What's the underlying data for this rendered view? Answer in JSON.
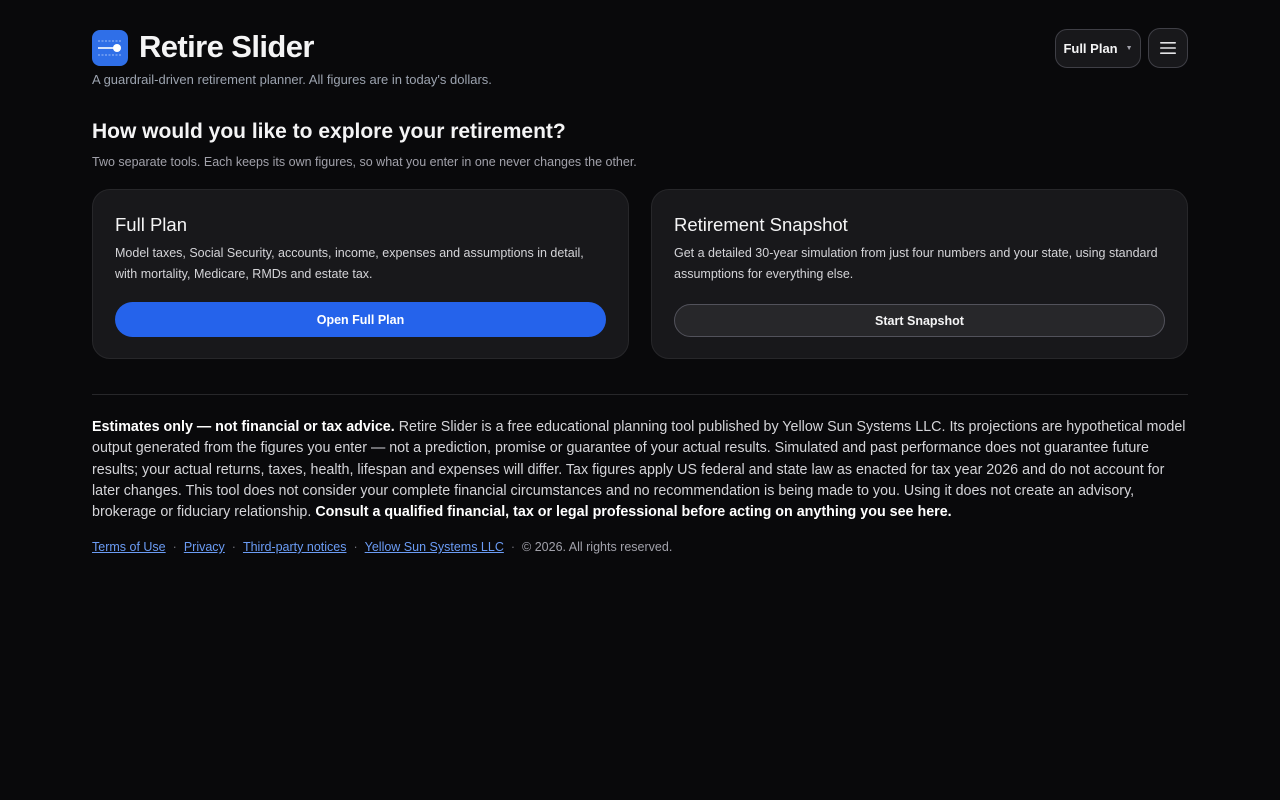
{
  "header": {
    "title": "Retire Slider",
    "tagline": "A guardrail-driven retirement planner. All figures are in today's dollars.",
    "plan_select": {
      "selected": "Full Plan"
    },
    "logo_icon": "slider-icon",
    "menu_icon": "hamburger-menu-icon",
    "accent_color": "#2f6fe8"
  },
  "intro": {
    "title": "How would you like to explore your retirement?",
    "subtitle": "Two separate tools. Each keeps its own figures, so what you enter in one never changes the other."
  },
  "cards": [
    {
      "title": "Full Plan",
      "description": "Model taxes, Social Security, accounts, income, expenses and assumptions in detail, with mortality, Medicare, RMDs and estate tax.",
      "button": "Open Full Plan"
    },
    {
      "title": "Retirement Snapshot",
      "description": "Get a detailed 30-year simulation from just four numbers and your state, using standard assumptions for everything else.",
      "button": "Start Snapshot"
    }
  ],
  "disclaimer": {
    "lead": "Estimates only — not financial or tax advice.",
    "body": " Retire Slider is a free educational planning tool published by Yellow Sun Systems LLC. Its projections are hypothetical model output generated from the figures you enter — not a prediction, promise or guarantee of your actual results. Simulated and past performance does not guarantee future results; your actual returns, taxes, health, lifespan and expenses will differ. Tax figures apply US federal and state law as enacted for tax year 2026 and do not account for later changes. This tool does not consider your complete financial circumstances and no recommendation is being made to you. Using it does not create an advisory, brokerage or fiduciary relationship. ",
    "closing": "Consult a qualified financial, tax or legal professional before acting on anything you see here."
  },
  "footer": {
    "links": [
      "Terms of Use",
      "Privacy",
      "Third-party notices",
      "Yellow Sun Systems LLC"
    ],
    "separator": "·",
    "copyright": "© 2026. All rights reserved."
  }
}
